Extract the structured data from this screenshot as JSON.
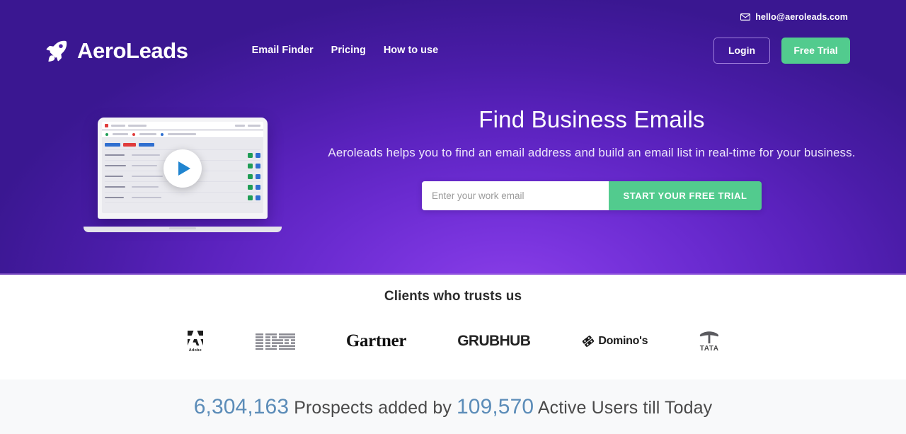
{
  "header": {
    "email_icon": "envelope-icon",
    "email": "hello@aeroleads.com",
    "logo_icon": "rocket-icon",
    "brand": "AeroLeads",
    "nav": [
      {
        "label": "Email Finder"
      },
      {
        "label": "Pricing"
      },
      {
        "label": "How to use"
      }
    ],
    "login_label": "Login",
    "free_trial_label": "Free Trial"
  },
  "hero": {
    "title": "Find Business Emails",
    "subtitle": "Aeroleads helps you to find an email address and build an email list in real-time for your business.",
    "email_placeholder": "Enter your work email",
    "email_value": "",
    "cta_label": "START YOUR FREE TRIAL",
    "video": {
      "play_icon": "play-icon",
      "device": "laptop-mockup"
    }
  },
  "clients": {
    "title": "Clients who trusts us",
    "logos": [
      {
        "name": "Adobe",
        "caption": "Adobe",
        "icon": "adobe-logo"
      },
      {
        "name": "IBM",
        "icon": "ibm-logo"
      },
      {
        "name": "Gartner",
        "icon": "gartner-logo"
      },
      {
        "name": "GRUBHUB",
        "icon": "grubhub-logo"
      },
      {
        "name": "Domino's",
        "icon": "dominos-logo"
      },
      {
        "name": "TATA",
        "icon": "tata-logo"
      }
    ]
  },
  "stats": {
    "prospects_count": "6,304,163",
    "prospects_label": "Prospects added by",
    "users_count": "109,570",
    "users_label": "Active Users till Today"
  },
  "colors": {
    "hero_dark": "#3a1791",
    "hero_bright": "#8b3fe8",
    "accent_green": "#52cb8e",
    "stat_blue": "#5b8cb8",
    "stats_bg": "#f8f9fa"
  }
}
